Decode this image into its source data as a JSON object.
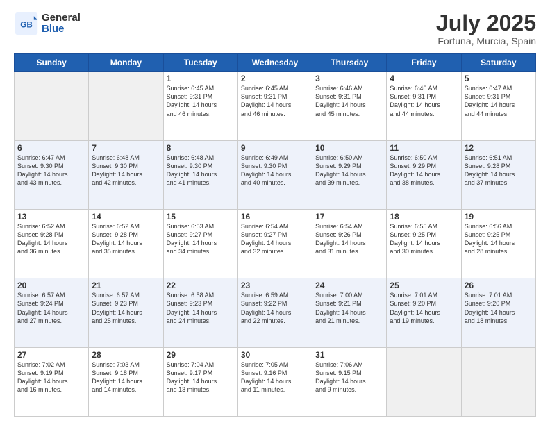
{
  "header": {
    "logo_general": "General",
    "logo_blue": "Blue",
    "title": "July 2025",
    "location": "Fortuna, Murcia, Spain"
  },
  "weekdays": [
    "Sunday",
    "Monday",
    "Tuesday",
    "Wednesday",
    "Thursday",
    "Friday",
    "Saturday"
  ],
  "weeks": [
    [
      {
        "day": "",
        "info": ""
      },
      {
        "day": "",
        "info": ""
      },
      {
        "day": "1",
        "info": "Sunrise: 6:45 AM\nSunset: 9:31 PM\nDaylight: 14 hours\nand 46 minutes."
      },
      {
        "day": "2",
        "info": "Sunrise: 6:45 AM\nSunset: 9:31 PM\nDaylight: 14 hours\nand 46 minutes."
      },
      {
        "day": "3",
        "info": "Sunrise: 6:46 AM\nSunset: 9:31 PM\nDaylight: 14 hours\nand 45 minutes."
      },
      {
        "day": "4",
        "info": "Sunrise: 6:46 AM\nSunset: 9:31 PM\nDaylight: 14 hours\nand 44 minutes."
      },
      {
        "day": "5",
        "info": "Sunrise: 6:47 AM\nSunset: 9:31 PM\nDaylight: 14 hours\nand 44 minutes."
      }
    ],
    [
      {
        "day": "6",
        "info": "Sunrise: 6:47 AM\nSunset: 9:30 PM\nDaylight: 14 hours\nand 43 minutes."
      },
      {
        "day": "7",
        "info": "Sunrise: 6:48 AM\nSunset: 9:30 PM\nDaylight: 14 hours\nand 42 minutes."
      },
      {
        "day": "8",
        "info": "Sunrise: 6:48 AM\nSunset: 9:30 PM\nDaylight: 14 hours\nand 41 minutes."
      },
      {
        "day": "9",
        "info": "Sunrise: 6:49 AM\nSunset: 9:30 PM\nDaylight: 14 hours\nand 40 minutes."
      },
      {
        "day": "10",
        "info": "Sunrise: 6:50 AM\nSunset: 9:29 PM\nDaylight: 14 hours\nand 39 minutes."
      },
      {
        "day": "11",
        "info": "Sunrise: 6:50 AM\nSunset: 9:29 PM\nDaylight: 14 hours\nand 38 minutes."
      },
      {
        "day": "12",
        "info": "Sunrise: 6:51 AM\nSunset: 9:28 PM\nDaylight: 14 hours\nand 37 minutes."
      }
    ],
    [
      {
        "day": "13",
        "info": "Sunrise: 6:52 AM\nSunset: 9:28 PM\nDaylight: 14 hours\nand 36 minutes."
      },
      {
        "day": "14",
        "info": "Sunrise: 6:52 AM\nSunset: 9:28 PM\nDaylight: 14 hours\nand 35 minutes."
      },
      {
        "day": "15",
        "info": "Sunrise: 6:53 AM\nSunset: 9:27 PM\nDaylight: 14 hours\nand 34 minutes."
      },
      {
        "day": "16",
        "info": "Sunrise: 6:54 AM\nSunset: 9:27 PM\nDaylight: 14 hours\nand 32 minutes."
      },
      {
        "day": "17",
        "info": "Sunrise: 6:54 AM\nSunset: 9:26 PM\nDaylight: 14 hours\nand 31 minutes."
      },
      {
        "day": "18",
        "info": "Sunrise: 6:55 AM\nSunset: 9:25 PM\nDaylight: 14 hours\nand 30 minutes."
      },
      {
        "day": "19",
        "info": "Sunrise: 6:56 AM\nSunset: 9:25 PM\nDaylight: 14 hours\nand 28 minutes."
      }
    ],
    [
      {
        "day": "20",
        "info": "Sunrise: 6:57 AM\nSunset: 9:24 PM\nDaylight: 14 hours\nand 27 minutes."
      },
      {
        "day": "21",
        "info": "Sunrise: 6:57 AM\nSunset: 9:23 PM\nDaylight: 14 hours\nand 25 minutes."
      },
      {
        "day": "22",
        "info": "Sunrise: 6:58 AM\nSunset: 9:23 PM\nDaylight: 14 hours\nand 24 minutes."
      },
      {
        "day": "23",
        "info": "Sunrise: 6:59 AM\nSunset: 9:22 PM\nDaylight: 14 hours\nand 22 minutes."
      },
      {
        "day": "24",
        "info": "Sunrise: 7:00 AM\nSunset: 9:21 PM\nDaylight: 14 hours\nand 21 minutes."
      },
      {
        "day": "25",
        "info": "Sunrise: 7:01 AM\nSunset: 9:20 PM\nDaylight: 14 hours\nand 19 minutes."
      },
      {
        "day": "26",
        "info": "Sunrise: 7:01 AM\nSunset: 9:20 PM\nDaylight: 14 hours\nand 18 minutes."
      }
    ],
    [
      {
        "day": "27",
        "info": "Sunrise: 7:02 AM\nSunset: 9:19 PM\nDaylight: 14 hours\nand 16 minutes."
      },
      {
        "day": "28",
        "info": "Sunrise: 7:03 AM\nSunset: 9:18 PM\nDaylight: 14 hours\nand 14 minutes."
      },
      {
        "day": "29",
        "info": "Sunrise: 7:04 AM\nSunset: 9:17 PM\nDaylight: 14 hours\nand 13 minutes."
      },
      {
        "day": "30",
        "info": "Sunrise: 7:05 AM\nSunset: 9:16 PM\nDaylight: 14 hours\nand 11 minutes."
      },
      {
        "day": "31",
        "info": "Sunrise: 7:06 AM\nSunset: 9:15 PM\nDaylight: 14 hours\nand 9 minutes."
      },
      {
        "day": "",
        "info": ""
      },
      {
        "day": "",
        "info": ""
      }
    ]
  ]
}
